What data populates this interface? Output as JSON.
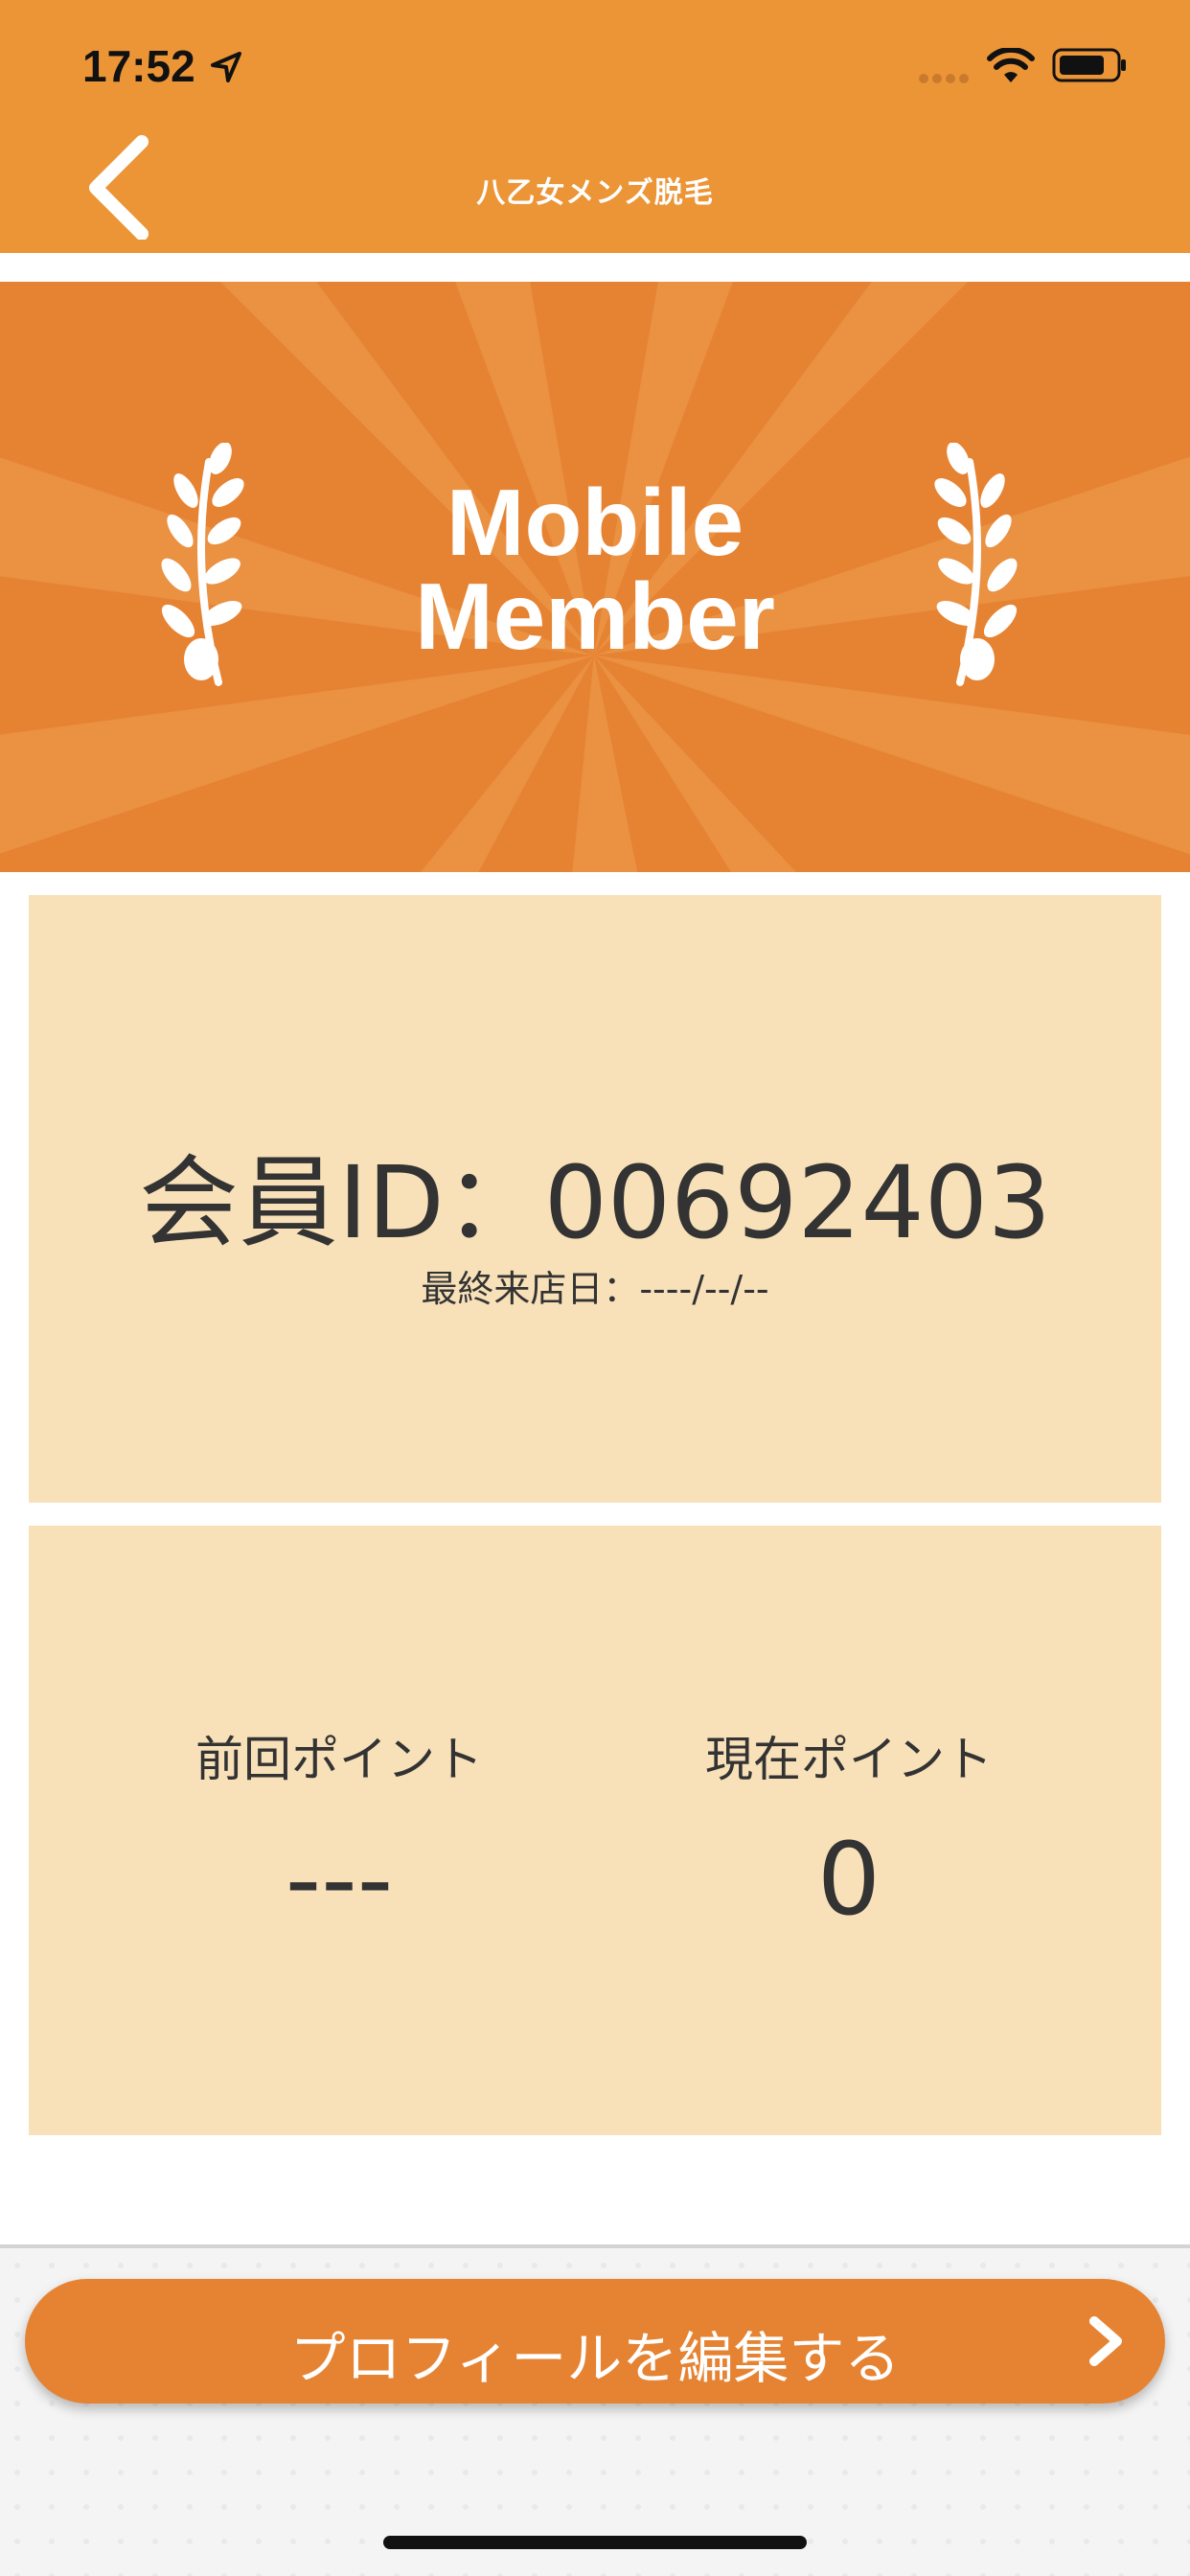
{
  "status_bar": {
    "time": "17:52",
    "location_icon": "location-arrow-icon",
    "signal_icon": "signal-dots-icon",
    "wifi_icon": "wifi-icon",
    "battery_icon": "battery-icon"
  },
  "header": {
    "title": "八乙女メンズ脱毛",
    "back_icon": "chevron-left-icon",
    "background_color": "#ec9537"
  },
  "hero": {
    "title_line1": "Mobile",
    "title_line2": "Member",
    "laurel_icon": "laurel-icon",
    "background_color": "#e68333"
  },
  "member_card": {
    "id_label": "会員ID：",
    "id_value": "00692403",
    "last_visit_label": "最終来店日：",
    "last_visit_value": "----/--/--",
    "background_color": "#f8e1b9"
  },
  "points_card": {
    "previous_label": "前回ポイント",
    "previous_value": "---",
    "current_label": "現在ポイント",
    "current_value": "0"
  },
  "footer": {
    "edit_profile_label": "プロフィールを編集する",
    "chevron_icon": "chevron-right-icon",
    "button_color": "#e68333"
  }
}
